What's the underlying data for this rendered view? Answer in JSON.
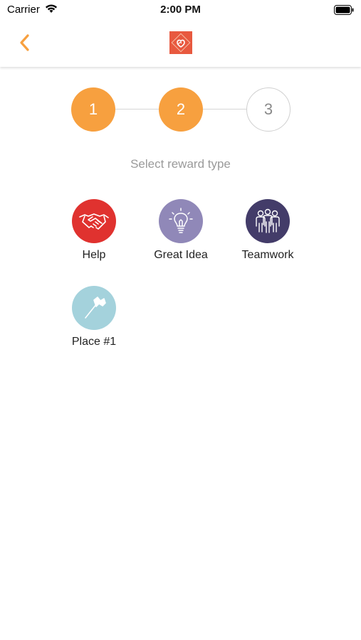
{
  "status_bar": {
    "carrier": "Carrier",
    "time": "2:00 PM"
  },
  "nav": {
    "logo_icon": "heart-link-logo-icon",
    "back_icon": "chevron-left-icon"
  },
  "stepper": {
    "steps": [
      {
        "label": "1",
        "state": "active"
      },
      {
        "label": "2",
        "state": "active"
      },
      {
        "label": "3",
        "state": "inactive"
      }
    ],
    "accent": "#f7a03f"
  },
  "subtitle": "Select reward type",
  "rewards": [
    {
      "label": "Help",
      "icon": "handshake-icon",
      "color": "#e0322f"
    },
    {
      "label": "Great Idea",
      "icon": "lightbulb-icon",
      "color": "#9088b8"
    },
    {
      "label": "Teamwork",
      "icon": "team-people-icon",
      "color": "#433c69"
    },
    {
      "label": "Place #1",
      "icon": "flag-icon",
      "color": "#a4d2dc"
    }
  ]
}
